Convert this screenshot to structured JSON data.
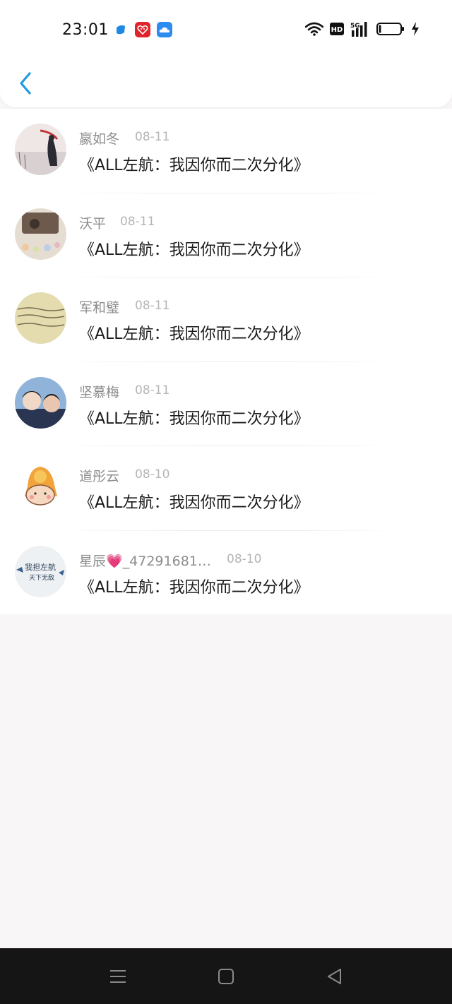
{
  "status_bar": {
    "time": "23:01",
    "app_icons": [
      "chat-app-icon",
      "heart-app-icon",
      "weather-app-icon"
    ],
    "system_icons": [
      "wifi-icon",
      "hd-icon",
      "5g-signal-icon",
      "battery-icon",
      "charging-icon"
    ],
    "network_label": "5G",
    "hd_label": "HD"
  },
  "header": {
    "back_icon": "chevron-left-icon",
    "accent_color": "#1e9be5"
  },
  "comments": [
    {
      "user": "嬴如冬",
      "date": "08-11",
      "text": "《ALL左航：我因你而二次分化》"
    },
    {
      "user": "沃平",
      "date": "08-11",
      "text": "《ALL左航：我因你而二次分化》"
    },
    {
      "user": "军和璧",
      "date": "08-11",
      "text": "《ALL左航：我因你而二次分化》"
    },
    {
      "user": "坚慕梅",
      "date": "08-11",
      "text": "《ALL左航：我因你而二次分化》"
    },
    {
      "user": "道彤云",
      "date": "08-10",
      "text": "《ALL左航：我因你而二次分化》"
    },
    {
      "user": "星辰💗_47291681…",
      "date": "08-10",
      "text": "《ALL左航：我因你而二次分化》"
    }
  ],
  "avatar_images": {
    "row5_text": "我担左航 天下无敌"
  },
  "nav_bar": {
    "buttons": [
      "menu-icon",
      "home-icon",
      "back-triangle-icon"
    ]
  }
}
